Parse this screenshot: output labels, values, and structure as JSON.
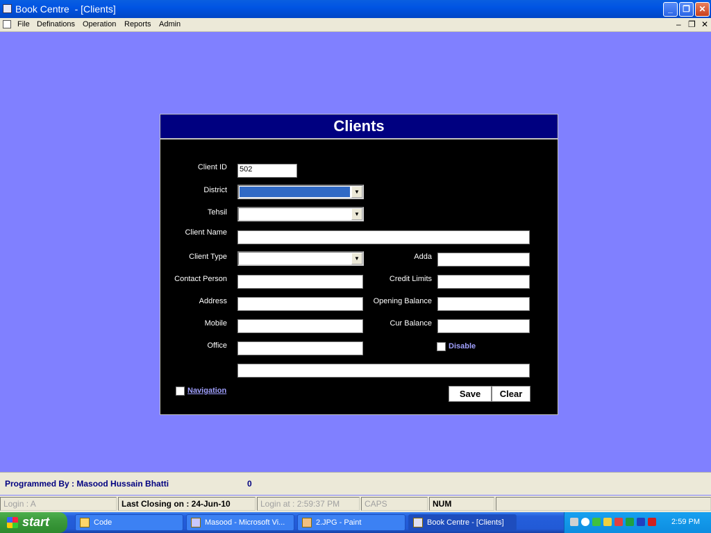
{
  "window": {
    "title": "Book Centre  - [Clients]"
  },
  "menu": [
    "File",
    "Definations",
    "Operation",
    "Reports",
    "Admin"
  ],
  "form": {
    "title": "Clients",
    "labels": {
      "client_id": "Client ID",
      "district": "District",
      "tehsil": "Tehsil",
      "client_name": "Client Name",
      "client_type": "Client Type",
      "contact_person": "Contact Person",
      "address": "Address",
      "mobile": "Mobile",
      "office": "Office",
      "adda": "Adda",
      "credit_limits": "Credit Limits",
      "opening_balance": "Opening Balance",
      "cur_balance": "Cur Balance"
    },
    "values": {
      "client_id": "502"
    },
    "disable_label": "Disable",
    "navigation_label": "Navigation",
    "save_label": "Save",
    "clear_label": "Clear"
  },
  "status": {
    "programmed_by": "Programmed By : Masood Hussain Bhatti",
    "count": "0",
    "login": "Login :  A",
    "last_closing": "Last Closing on : 24-Jun-10",
    "login_at": "Login at : 2:59:37 PM",
    "caps": "CAPS",
    "num": "NUM"
  },
  "taskbar": {
    "start": "start",
    "tasks": [
      "Code",
      "Masood - Microsoft Vi...",
      "2.JPG - Paint",
      "Book Centre  - [Clients]"
    ],
    "clock": "2:59 PM"
  },
  "colors": {
    "desktop": "#8080ff",
    "form_header": "#000080",
    "form_body": "#000000",
    "status_text": "#000080"
  }
}
